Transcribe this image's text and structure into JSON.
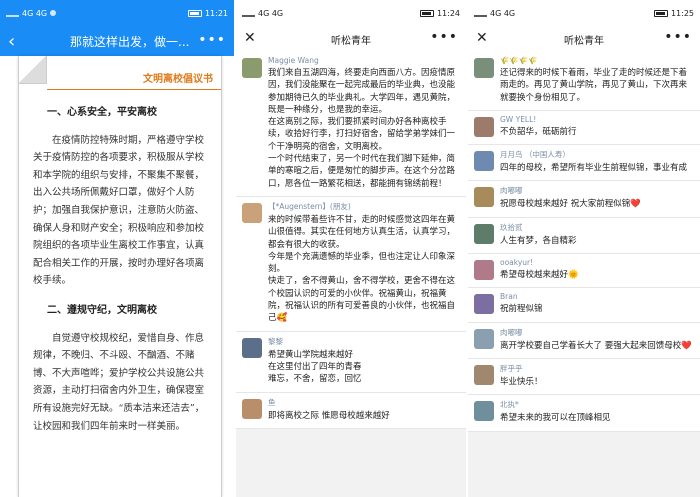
{
  "status": {
    "p1": {
      "left": "4G 4G",
      "time": "11:21"
    },
    "p2": {
      "left": "4G 4G",
      "time": "11:24"
    },
    "p3": {
      "left": "4G 4G",
      "time": "11:25"
    }
  },
  "panel1": {
    "nav_title": "那就这样出发，做一...",
    "doc_title": "文明离校倡议书",
    "s1_heading": "一、心系安全，平安离校",
    "s1_text": "在疫情防控特殊时期，严格遵守学校关于疫情防控的各项要求，积极服从学校和本学院的组织与安排，不聚集不聚餐，出入公共场所佩戴好口罩，做好个人防护；加强自我保护意识，注意防火防盗、确保人身和财产安全；积极响应和参加校院组织的各项毕业生离校工作事宜，认真配合相关工作的开展，按时办理好各项离校手续。",
    "s2_heading": "二、遵规守纪，文明离校",
    "s2_text": "自觉遵守校规校纪，爱惜自身、作息规律，不晚归、不斗殴、不酗酒、不赌博、不大声喧哗；爱护学校公共设施公共资源，主动打扫宿舍内外卫生，确保寝室所有设施完好无缺。“质本洁来还洁去”，让校园和我们四年前来时一样美丽。"
  },
  "panel2": {
    "title": "听松青年",
    "comments": [
      {
        "name": "Maggie Wang",
        "text": "我们来自五湖四海，终要走向西面八方。因疫情原因，我们没能聚在一起完成最后的毕业典，也没能参加期待已久的毕业典礼。大学四年，遇见黄院，既是一种缘分，也是我的幸运。\n在这离别之际，我们要抓紧时间办好各种离校手续，收拾好行李，打扫好宿舍，留给学弟学妹们一个干净明亮的宿舍，文明离校。\n一个时代结束了，另一个时代在我们脚下延伸，简单的寒暄之后，便是匆忙的脚步声。在这个分岔路口，愿各位一路繁花相送，都能拥有锦绣前程！"
      },
      {
        "name": "【*Augenstern】(朋友)",
        "text": "来的时候带着些许不甘，走的时候感觉这四年在黄山很值得。其实在任何地方认真生活，认真学习，都会有很大的收获。\n今年是个充满遗憾的毕业季，但也注定让人印象深刻。\n快走了，舍不得黄山，舍不得学校，更舍不得在这个校园认识的可爱的小伙伴。祝福黄山，祝福黄院，祝福认识的所有可爱善良的小伙伴，也祝福自己🥰"
      },
      {
        "name": "黎黎",
        "text": "希望黄山学院越来越好\n在这里付出了四年的青春\n难忘，不舍，留恋，回忆"
      },
      {
        "name": "鱼",
        "text": "即将离校之际 惟愿母校越来越好"
      }
    ]
  },
  "panel3": {
    "title": "听松青年",
    "comments": [
      {
        "name": "🌾🌾🌾🌾",
        "text": "还记得来的时候下着雨，毕业了走的时候还是下着雨走的。再见了黄山学院，再见了黄山，下次再来就要换个身份相见了。"
      },
      {
        "name": "GW YELL!",
        "text": "不负韶华，砥砺前行"
      },
      {
        "name": "月月鸟 （中国人寿）",
        "text": "四年的母校，希望所有毕业生前程似锦，事业有成"
      },
      {
        "name": "肉嘟嘟",
        "text": "祝愿母校越来越好 祝大家前程似锦❤️"
      },
      {
        "name": "玖拾贰",
        "text": "人生有梦，各自精彩"
      },
      {
        "name": "ooakyur!",
        "text": "希望母校越来越好🌞"
      },
      {
        "name": "Bran",
        "text": "祝前程似锦"
      },
      {
        "name": "肉嘟嘟",
        "text": "离开学校要自己学着长大了 要强大起来回馈母校❤️"
      },
      {
        "name": "胖乎乎",
        "text": "毕业快乐！"
      },
      {
        "name": "北执*",
        "text": "希望未来的我可以在顶峰相见"
      }
    ]
  },
  "avatar_colors": [
    "#8a9b6e",
    "#c9a27a",
    "#5b6f8a",
    "#b98f6b",
    "#7a8f7a",
    "#9c7b6a",
    "#6e8ab0",
    "#a88b5a",
    "#5e7c6a",
    "#b07a8a",
    "#7c6ea0",
    "#8aa0b0",
    "#a0886e",
    "#6f8f9c"
  ]
}
